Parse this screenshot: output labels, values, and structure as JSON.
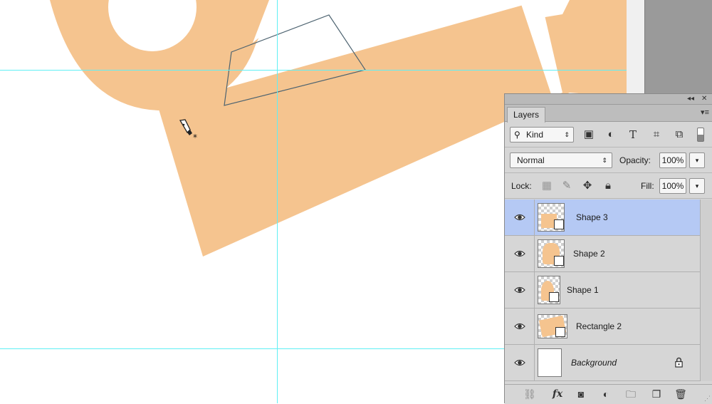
{
  "layers_panel": {
    "tab_title": "Layers",
    "titlebar_collapse": "◂◂",
    "titlebar_close": "✕",
    "panel_menu_icon": "▾≡",
    "filter": {
      "search_icon": "⚲",
      "kind_value": "Kind",
      "icons": [
        "image-filter-icon",
        "adjustment-filter-icon",
        "type-filter-icon",
        "shape-filter-icon",
        "smart-object-filter-icon",
        "filter-toggle-icon"
      ]
    },
    "blend_mode": "Normal",
    "opacity_label": "Opacity:",
    "opacity_value": "100%",
    "lock_label": "Lock:",
    "fill_label": "Fill:",
    "fill_value": "100%",
    "layers": [
      {
        "name": "Shape 3",
        "selected": true,
        "italic": false,
        "locked": false
      },
      {
        "name": "Shape 2",
        "selected": false,
        "italic": false,
        "locked": false
      },
      {
        "name": "Shape 1",
        "selected": false,
        "italic": false,
        "locked": false
      },
      {
        "name": "Rectangle 2",
        "selected": false,
        "italic": false,
        "locked": false
      },
      {
        "name": "Background",
        "selected": false,
        "italic": true,
        "locked": true
      }
    ],
    "bottom_icons": [
      "link-layers-icon",
      "fx-icon",
      "add-mask-icon",
      "adjustment-layer-icon",
      "new-group-icon",
      "new-layer-icon",
      "trash-icon"
    ],
    "fx_label": "fx"
  },
  "colors": {
    "shape_fill": "#f5c48f",
    "guide": "#5ff0f5",
    "selection": "#b5c9f4",
    "panel_bg": "#d6d6d6"
  }
}
